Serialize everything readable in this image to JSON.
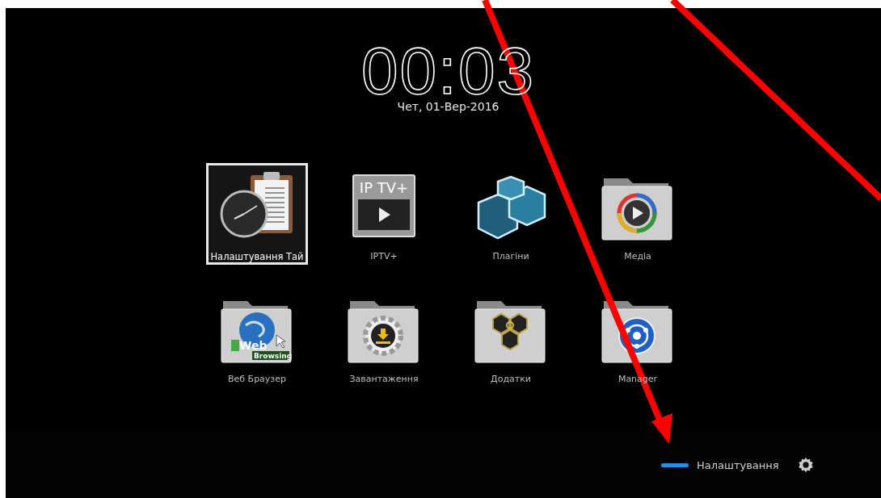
{
  "clock": {
    "time": "00:03",
    "date": "Чет, 01-Вер-2016"
  },
  "apps": [
    {
      "label": "Налаштування Тай",
      "kind": "timer",
      "selected": true
    },
    {
      "label": "IPTV+",
      "kind": "iptv",
      "icon_text": "IP TV+",
      "selected": false
    },
    {
      "label": "Плагіни",
      "kind": "plugins",
      "selected": false
    },
    {
      "label": "Медіа",
      "kind": "media",
      "selected": false
    },
    {
      "label": "Веб Браузер",
      "kind": "web",
      "icon_text": "Web",
      "icon_subtext": "Browsing",
      "selected": false
    },
    {
      "label": "Завантаження",
      "kind": "download",
      "selected": false
    },
    {
      "label": "Додатки",
      "kind": "addons",
      "selected": false
    },
    {
      "label": "Manager",
      "kind": "manager",
      "selected": false
    }
  ],
  "footer": {
    "label": "Налаштування"
  }
}
